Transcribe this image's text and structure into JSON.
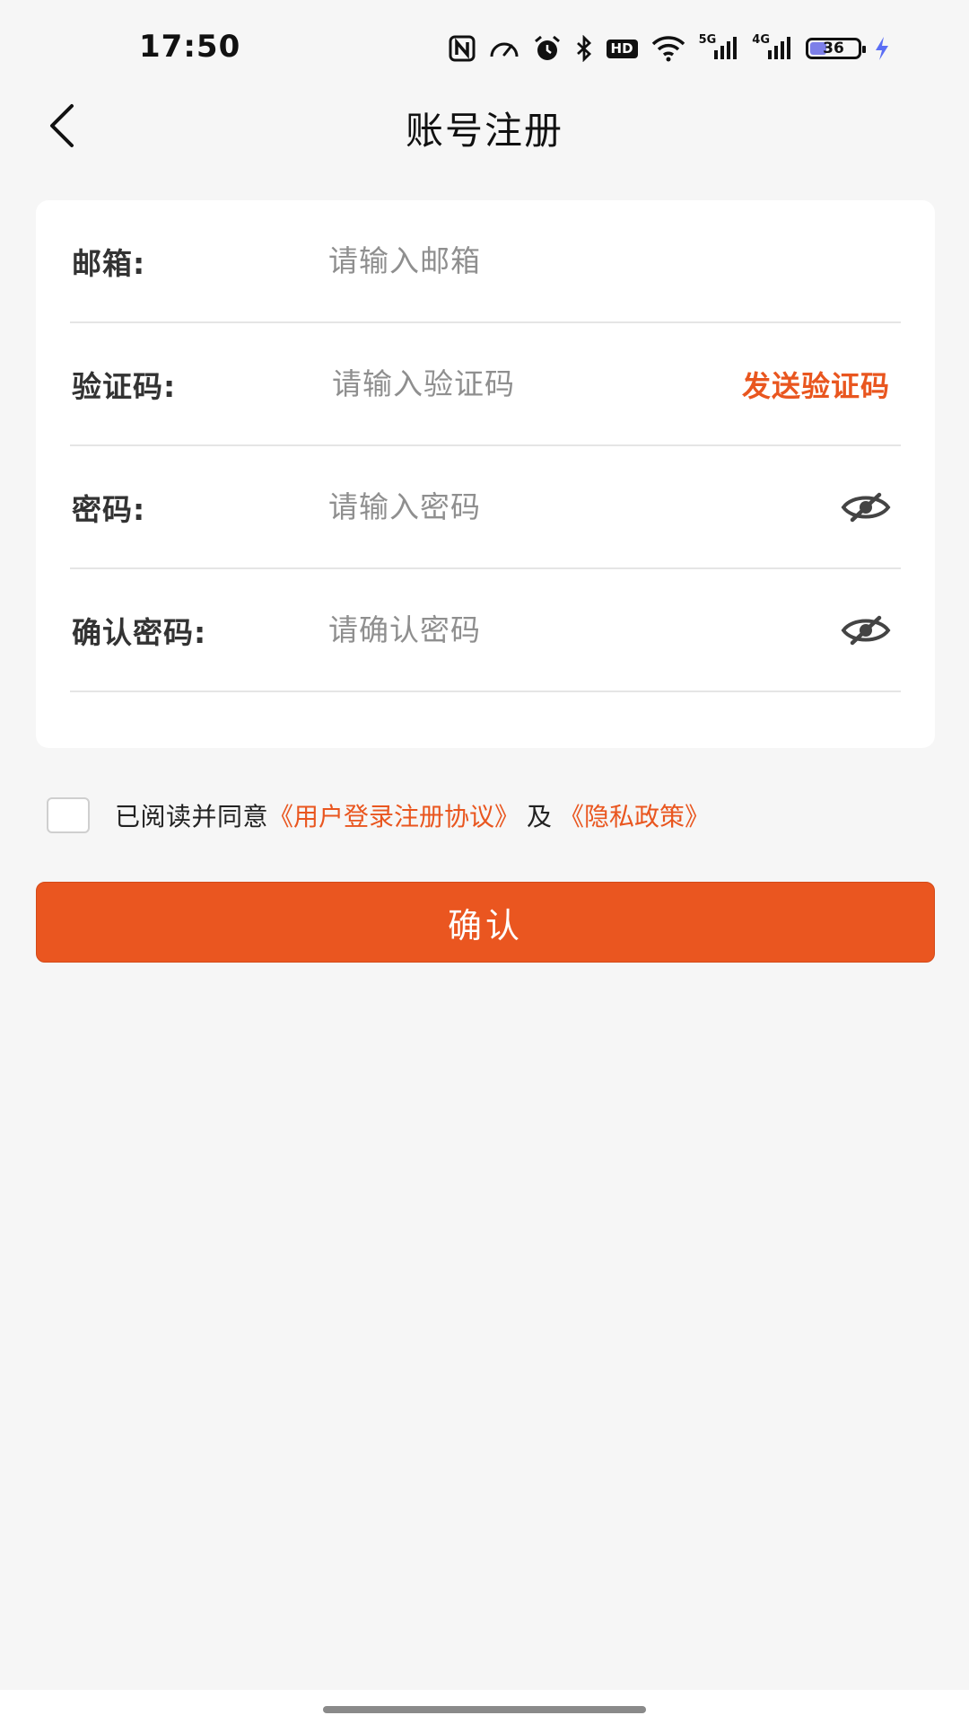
{
  "status_bar": {
    "time": "17:50",
    "icons": [
      "nfc-icon",
      "speedometer-icon",
      "alarm-icon",
      "bluetooth-icon",
      "hd-voice-icon",
      "wifi-icon",
      "signal-5g-icon",
      "signal-4g-icon",
      "battery-icon",
      "charging-icon"
    ],
    "hd_label": "HD",
    "network_1": "5G",
    "network_2": "4G",
    "battery_level": "36",
    "battery_fraction": 0.36
  },
  "header": {
    "title": "账号注册",
    "back_icon": "chevron-left-icon"
  },
  "form": {
    "email": {
      "label": "邮箱:",
      "placeholder": "请输入邮箱",
      "value": ""
    },
    "code": {
      "label": "验证码:",
      "placeholder": "请输入验证码",
      "value": "",
      "send_label": "发送验证码"
    },
    "password": {
      "label": "密码:",
      "placeholder": "请输入密码",
      "value": "",
      "toggle_icon": "eye-off-icon"
    },
    "confirm_password": {
      "label": "确认密码:",
      "placeholder": "请确认密码",
      "value": "",
      "toggle_icon": "eye-off-icon"
    }
  },
  "agreement": {
    "checked": false,
    "prefix": "已阅读并同意",
    "terms_link": "《用户登录注册协议》",
    "conjunction": "及",
    "privacy_link": "《隐私政策》"
  },
  "confirm_button": {
    "label": "确认"
  },
  "colors": {
    "accent": "#ea5620",
    "background": "#f6f6f6",
    "card": "#ffffff",
    "battery_fill": "#7d7fe8"
  }
}
